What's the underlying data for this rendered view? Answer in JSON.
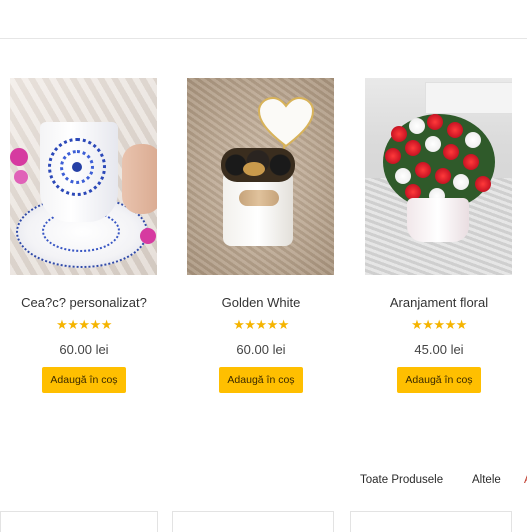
{
  "products": [
    {
      "title": "Cea?c? personalizat?",
      "stars": "★★★★★",
      "price": "60.00 lei",
      "button": "Adaugă în coș",
      "image": "dot-mandala-mug"
    },
    {
      "title": "Golden White",
      "stars": "★★★★★",
      "price": "60.00 lei",
      "button": "Adaugă în coș",
      "image": "golden-white-box"
    },
    {
      "title": "Aranjament floral",
      "stars": "★★★★★",
      "price": "45.00 lei",
      "button": "Adaugă în coș",
      "image": "floral-arrangement"
    }
  ],
  "filters": [
    "Toate Produsele",
    "Altele",
    "A"
  ],
  "colors": {
    "accent": "#ffbf00",
    "stars": "#f5b400"
  }
}
